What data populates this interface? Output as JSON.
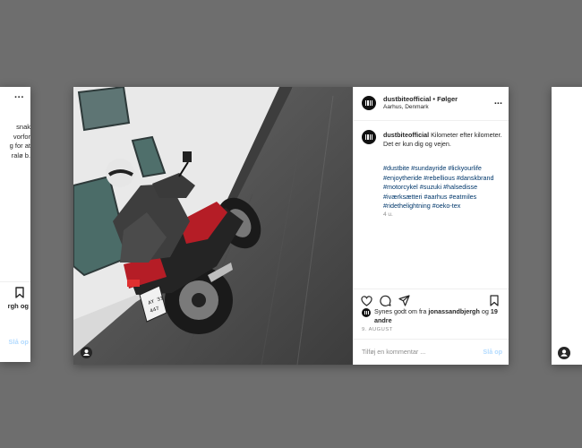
{
  "left_card": {
    "more": "...",
    "text_lines": [
      "snak",
      "vorfor",
      "g for at",
      "ralø b."
    ],
    "likes_line": "rgh og",
    "post_label": "Slå op"
  },
  "main": {
    "header": {
      "username": "dustbiteofficial",
      "separator": " • ",
      "follow": "Følger",
      "location": "Aarhus, Denmark",
      "more": "..."
    },
    "caption": {
      "username": "dustbiteofficial",
      "text": " Kilometer efter kilometer. Det er kun dig og vejen.",
      "hashtags": "#dustbite #sundayride #lickyourlife #enjoytheride #rebellious #danskbrand #motorcykel #suzuki #halsedisse #iværksætteri #aarhus #eatmiles #ridethelightning #oeko-tex",
      "age": "4 u."
    },
    "actions": {
      "icons": [
        "heart-icon",
        "comment-icon",
        "share-icon",
        "bookmark-icon"
      ]
    },
    "likes": {
      "prefix": "Synes godt om fra ",
      "user": "jonassandbjergh",
      "middle": " og ",
      "others": "19 andre"
    },
    "date": "9. AUGUST",
    "comment": {
      "placeholder": "Tilføj en kommentar ...",
      "post_label": "Slå op"
    },
    "photo": {
      "plate": "AY 31 447"
    }
  },
  "colors": {
    "background": "#6e6e6e",
    "link": "#00376b",
    "post_disabled": "#b3dbff",
    "muted": "#8e8e8e"
  }
}
